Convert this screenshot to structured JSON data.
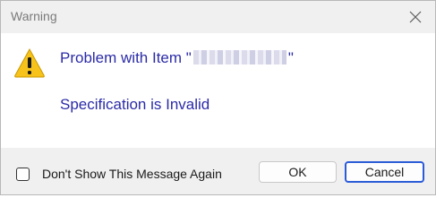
{
  "window": {
    "title": "Warning"
  },
  "message": {
    "line1_prefix": "Problem with Item \"",
    "line1_suffix": "\"",
    "line2": "Specification is Invalid"
  },
  "footer": {
    "checkbox_label": "Don't Show This Message Again",
    "checkbox_checked": false,
    "ok_label": "OK",
    "cancel_label": "Cancel"
  },
  "icons": {
    "warning": "warning-icon",
    "close": "close-icon"
  },
  "colors": {
    "message_text": "#2b2ba8",
    "titlebar_bg": "#f0f0f0",
    "default_button_border": "#2b5bd7",
    "warning_yellow": "#f7c31a"
  }
}
